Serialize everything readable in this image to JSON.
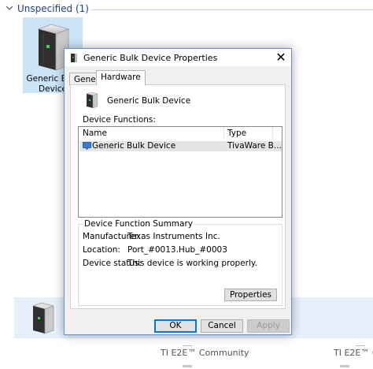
{
  "background": {
    "group_title": "Unspecified (1)",
    "device_label": "Generic Bulk\nDevice",
    "footer_left": "TI E2E™ Community",
    "footer_right": "TI E2E™ Commun"
  },
  "dialog": {
    "title": "Generic Bulk Device Properties",
    "close_glyph": "✕",
    "tabs": [
      {
        "label": "General",
        "active": false
      },
      {
        "label": "Hardware",
        "active": true
      }
    ],
    "device_name": "Generic Bulk Device",
    "functions_label": "Device Functions:",
    "columns": [
      "Name",
      "Type"
    ],
    "rows": [
      {
        "name": "Generic Bulk Device",
        "type": "TivaWare B...",
        "selected": true
      }
    ],
    "summary": {
      "title": "Device Function Summary",
      "manufacturer_label": "Manufacturer:",
      "manufacturer_value": "Texas Instruments Inc.",
      "location_label": "Location:",
      "location_value": "Port_#0013.Hub_#0003",
      "status_label": "Device status:",
      "status_value": "This device is working properly.",
      "properties_button": "Properties"
    },
    "buttons": {
      "ok": "OK",
      "cancel": "Cancel",
      "apply": "Apply"
    }
  },
  "colors": {
    "accent": "#0078d7",
    "selection": "#cce4f7",
    "group_title": "#1e3f8a"
  },
  "icons": [
    "chevron-down-icon",
    "drive-icon",
    "monitor-icon",
    "close-icon"
  ]
}
